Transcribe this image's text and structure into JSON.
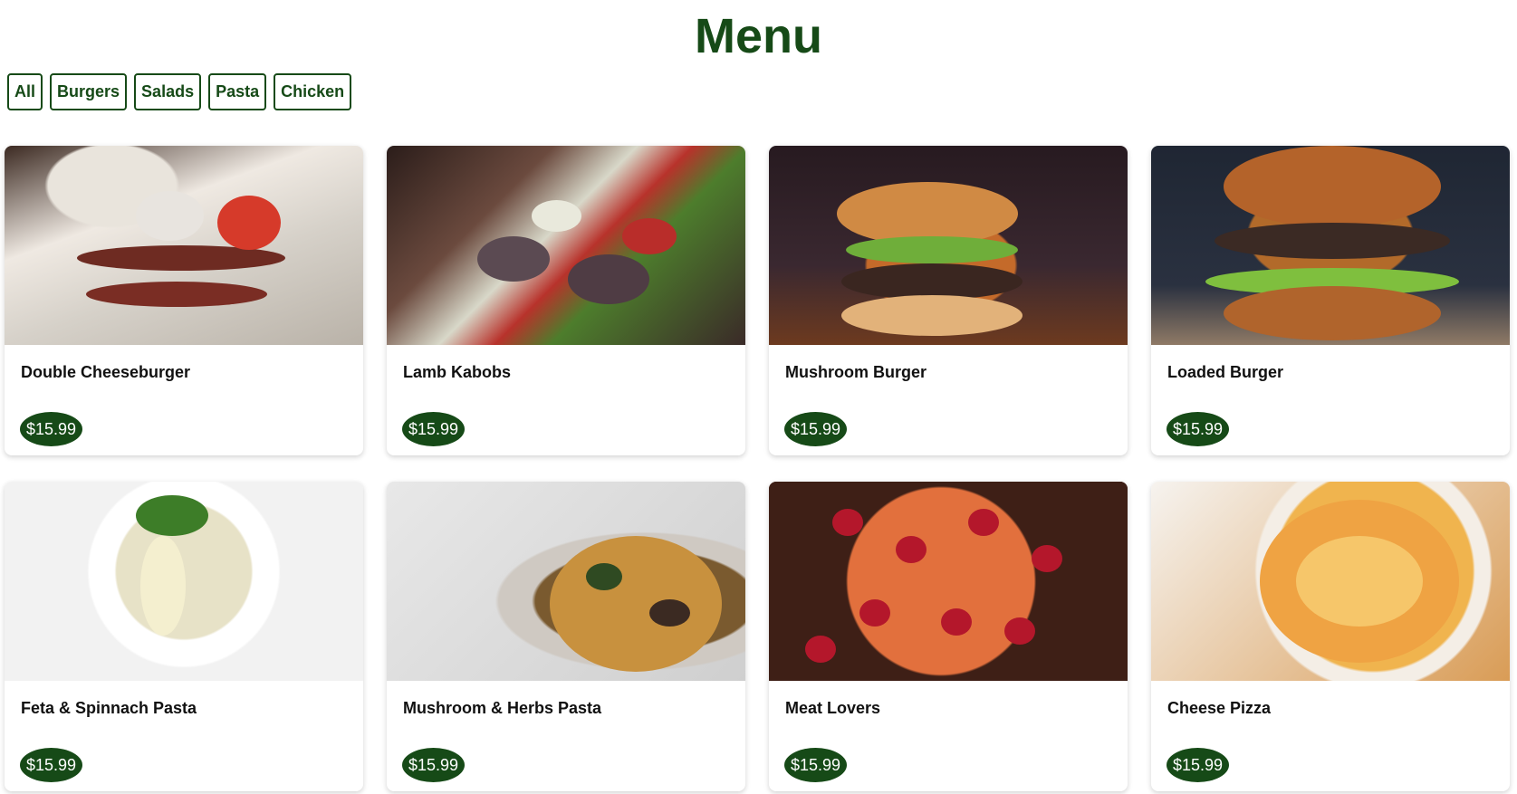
{
  "page": {
    "title": "Menu"
  },
  "filters": [
    {
      "label": "All"
    },
    {
      "label": "Burgers"
    },
    {
      "label": "Salads"
    },
    {
      "label": "Pasta"
    },
    {
      "label": "Chicken"
    }
  ],
  "items": [
    {
      "name": "Double Cheeseburger",
      "price": "$15.99",
      "image": "kebab-plate"
    },
    {
      "name": "Lamb Kabobs",
      "price": "$15.99",
      "image": "kabobs"
    },
    {
      "name": "Mushroom Burger",
      "price": "$15.99",
      "image": "mushroom-burger"
    },
    {
      "name": "Loaded Burger",
      "price": "$15.99",
      "image": "loaded-burger"
    },
    {
      "name": "Feta & Spinnach Pasta",
      "price": "$15.99",
      "image": "feta-pasta"
    },
    {
      "name": "Mushroom & Herbs Pasta",
      "price": "$15.99",
      "image": "mushroom-pasta"
    },
    {
      "name": "Meat Lovers",
      "price": "$15.99",
      "image": "pepperoni-pizza"
    },
    {
      "name": "Cheese Pizza",
      "price": "$15.99",
      "image": "cheese-pizza"
    }
  ],
  "colors": {
    "accent": "#164a17",
    "price_text": "#ffffff",
    "card_bg": "#ffffff"
  }
}
